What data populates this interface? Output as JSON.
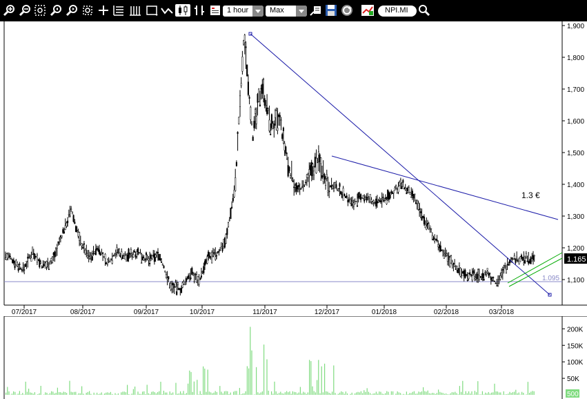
{
  "toolbar": {
    "icons": [
      "zoom-in-icon",
      "zoom-out-icon",
      "zoom-fit-icon",
      "zoom-x-in-icon",
      "zoom-x-out-icon",
      "zoom-box-icon",
      "crosshair-icon",
      "bar-chart-icon",
      "ohlc-chart-icon",
      "rectangle-chart-icon",
      "line-chart-icon",
      "candlestick-icon",
      "hl-bars-icon",
      "indicators-icon"
    ],
    "interval": "1 hour",
    "range": "Max",
    "tools": [
      "annotation-icon",
      "save-icon",
      "refresh-icon",
      "compare-icon"
    ],
    "symbol": "NPI.MI",
    "search_icon": "search-icon"
  },
  "chart_data": [
    {
      "type": "candlestick",
      "symbol": "NPI.MI",
      "x_ticks": [
        "07/2017",
        "08/2017",
        "09/2017",
        "10/2017",
        "11/2017",
        "12/2017",
        "01/2018",
        "02/2018",
        "03/2018"
      ],
      "y_ticks": [
        "1,900",
        "1,800",
        "1,700",
        "1,600",
        "1,500",
        "1,400",
        "1,300",
        "1,200",
        "1,100"
      ],
      "ylim": [
        1.035,
        1.905
      ],
      "last_price": "1.165",
      "reference_line": {
        "value": 1.095,
        "label": "1.095"
      },
      "annotation": "1.3 €",
      "price_path": [
        [
          "07/2017",
          1.18
        ],
        [
          1.16
        ],
        [
          1.13
        ],
        [
          1.19
        ],
        [
          1.14
        ],
        [
          1.16
        ],
        [
          "08/2017",
          1.24
        ],
        [
          1.32
        ],
        [
          1.22
        ],
        [
          1.17
        ],
        [
          1.2
        ],
        [
          1.15
        ],
        [
          1.19
        ],
        [
          "09/2017",
          1.17
        ],
        [
          1.19
        ],
        [
          1.16
        ],
        [
          1.18
        ],
        [
          1.08
        ],
        [
          "10/2017",
          1.07
        ],
        [
          1.12
        ],
        [
          1.1
        ],
        [
          1.17
        ],
        [
          1.18
        ],
        [
          1.23
        ],
        [
          1.4
        ],
        [
          "11/2017",
          1.87
        ],
        [
          1.55
        ],
        [
          1.72
        ],
        [
          1.58
        ],
        [
          1.6
        ],
        [
          1.45
        ],
        [
          1.38
        ],
        [
          "12/2017",
          1.4
        ],
        [
          1.48
        ],
        [
          1.4
        ],
        [
          1.38
        ],
        [
          1.34
        ],
        [
          "01/2018",
          1.36
        ],
        [
          1.34
        ],
        [
          1.36
        ],
        [
          1.4
        ],
        [
          1.36
        ],
        [
          "02/2018",
          1.28
        ],
        [
          1.18
        ],
        [
          1.12
        ],
        [
          "03/2018",
          1.11
        ],
        [
          1.12
        ],
        [
          1.09
        ],
        [
          1.12
        ],
        [
          1.165
        ]
      ],
      "trend_lines": [
        {
          "from": [
            "11/2017 start",
            1.87
          ],
          "to": [
            "03/2018 end",
            1.05
          ],
          "color": "#1a1aa8"
        },
        {
          "from": [
            "12/2017 start",
            1.49
          ],
          "to": [
            "03/2018 end",
            1.29
          ],
          "color": "#1a1aa8"
        }
      ],
      "channel_lines": {
        "color": "#00aa00"
      }
    },
    {
      "type": "bar",
      "series_name": "volume",
      "y_ticks": [
        "200K",
        "150K",
        "100K",
        "50K"
      ],
      "ylim": [
        0,
        230000
      ],
      "last_volume_label": "500",
      "peak_volumes": [
        [
          "11/2017",
          230000
        ],
        [
          "10/2017",
          105000
        ],
        [
          "12/2017",
          110000
        ]
      ]
    }
  ]
}
